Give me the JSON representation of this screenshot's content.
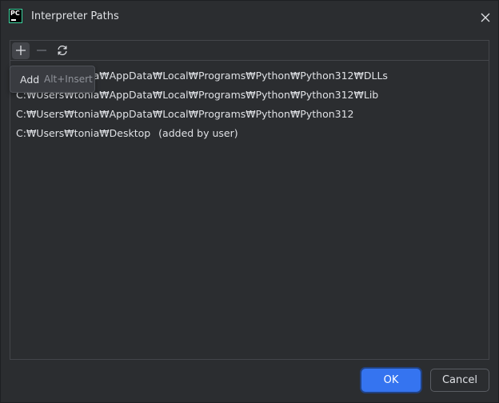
{
  "window": {
    "title": "Interpreter Paths",
    "app_icon": "pycharm-logo",
    "app_icon_text": "PC"
  },
  "toolbar": {
    "add_icon": "plus-icon",
    "remove_icon": "minus-icon",
    "reload_icon": "refresh-icon"
  },
  "tooltip": {
    "label": "Add",
    "shortcut": "Alt+Insert"
  },
  "paths": [
    {
      "text": "C:₩Users₩tonia₩AppData₩Local₩Programs₩Python₩Python312₩DLLs",
      "note": ""
    },
    {
      "text": "C:₩Users₩tonia₩AppData₩Local₩Programs₩Python₩Python312₩Lib",
      "note": ""
    },
    {
      "text": "C:₩Users₩tonia₩AppData₩Local₩Programs₩Python₩Python312",
      "note": ""
    },
    {
      "text": "C:₩Users₩tonia₩Desktop",
      "note": "(added by user)"
    }
  ],
  "buttons": {
    "ok": "OK",
    "cancel": "Cancel"
  },
  "colors": {
    "background": "#2b2d30",
    "accent": "#3574f0",
    "text": "#dfe1e5",
    "muted": "#8f9299",
    "border": "#43454a"
  }
}
